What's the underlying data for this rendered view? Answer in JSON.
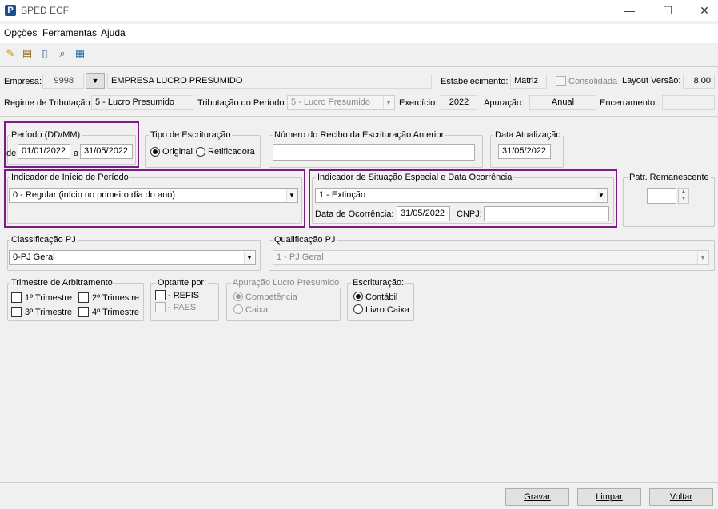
{
  "window": {
    "title": "SPED ECF",
    "app_icon": "P",
    "minimize": "—",
    "maximize": "☐",
    "close": "✕"
  },
  "menu": {
    "items": [
      "Opções",
      "Ferramentas",
      "Ajuda"
    ]
  },
  "toolbar": {
    "icons": [
      "pencil-icon",
      "properties-icon",
      "document-icon",
      "preview-icon",
      "calculator-icon"
    ]
  },
  "header": {
    "empresa_label": "Empresa:",
    "empresa_code": "9998",
    "empresa_name": "EMPRESA LUCRO PRESUMIDO",
    "estabelecimento_label": "Estabelecimento:",
    "estabelecimento_value": "Matriz",
    "consolidada_label": "Consolidada",
    "layout_label": "Layout Versão:",
    "layout_value": "8.00",
    "regime_label": "Regime de Tributação:",
    "regime_value": "5 - Lucro Presumido",
    "tributacao_label": "Tributação do Período:",
    "tributacao_value": "5 - Lucro Presumido",
    "exercicio_label": "Exercício:",
    "exercicio_value": "2022",
    "apuracao_label": "Apuração:",
    "apuracao_value": "Anual",
    "encerramento_label": "Encerramento:",
    "encerramento_value": ""
  },
  "periodo": {
    "title": "Período (DD/MM)",
    "de_label": "de",
    "de_value": "01/01/2022",
    "a_label": "a",
    "a_value": "31/05/2022"
  },
  "tipo_escrituracao": {
    "title": "Tipo de Escrituração",
    "original": "Original",
    "retificadora": "Retificadora"
  },
  "recibo": {
    "title": "Número do Recibo da Escrituração Anterior",
    "value": ""
  },
  "data_atualizacao": {
    "title": "Data Atualização",
    "value": "31/05/2022"
  },
  "indicador_inicio": {
    "title": "Indicador de Início de Período",
    "value": "0 - Regular (início no primeiro dia do ano)"
  },
  "situacao_especial": {
    "title": "Indicador de Situação Especial e Data Ocorrência",
    "value": "1 - Extinção",
    "data_label": "Data de Ocorrência:",
    "data_value": "31/05/2022",
    "cnpj_label": "CNPJ:",
    "cnpj_value": ""
  },
  "patr": {
    "title": "Patr. Remanescente",
    "value": ""
  },
  "classificacao": {
    "title": "Classificação PJ",
    "value": "0-PJ Geral"
  },
  "qualificacao": {
    "title": "Qualificação PJ",
    "value": "1 - PJ Geral"
  },
  "trimestre": {
    "title": "Trimestre de Arbitramento",
    "t1": "1º Trimestre",
    "t2": "2º Trimestre",
    "t3": "3º Trimestre",
    "t4": "4º Trimestre"
  },
  "optante": {
    "title": "Optante por:",
    "refis": "- REFIS",
    "paes": "- PAES"
  },
  "apuracao_lp": {
    "title": "Apuração Lucro Presumido",
    "competencia": "Competência",
    "caixa": "Caixa"
  },
  "escrituracao": {
    "title": "Escrituração:",
    "contabil": "Contábil",
    "livro_caixa": "Livro Caixa"
  },
  "buttons": {
    "gravar": "Gravar",
    "limpar": "Limpar",
    "voltar": "Voltar"
  }
}
